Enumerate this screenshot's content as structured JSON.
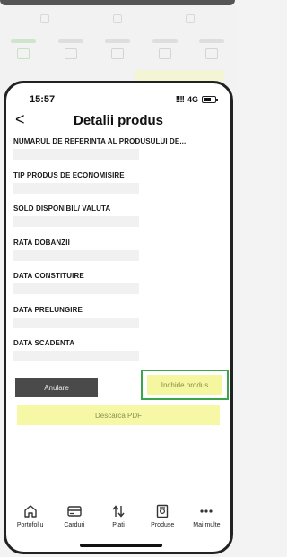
{
  "status_bar": {
    "time": "15:57",
    "signal": "!!!!",
    "network": "4G"
  },
  "header": {
    "back_icon": "chevron-left-icon",
    "back_glyph": "<",
    "title": "Detalii produs"
  },
  "fields": [
    {
      "label": "NUMARUL DE REFERINTA AL PRODUSULUI DE..."
    },
    {
      "label": "TIP PRODUS DE ECONOMISIRE"
    },
    {
      "label": "SOLD DISPONIBIL/ VALUTA"
    },
    {
      "label": "RATA DOBANZII"
    },
    {
      "label": "DATA CONSTITUIRE"
    },
    {
      "label": "DATA PRELUNGIRE"
    },
    {
      "label": "DATA SCADENTA"
    }
  ],
  "actions": {
    "cancel_label": "Anulare",
    "close_product_label": "Inchide produs",
    "pdf_label": "Descarca PDF"
  },
  "tabs": [
    {
      "label": "Portofoliu",
      "icon": "home-icon"
    },
    {
      "label": "Carduri",
      "icon": "card-icon"
    },
    {
      "label": "Plati",
      "icon": "transfer-icon"
    },
    {
      "label": "Produse",
      "icon": "document-icon"
    },
    {
      "label": "Mai multe",
      "icon": "more-icon"
    }
  ],
  "colors": {
    "highlight_border": "#3aa54a",
    "yellow_button": "#f5f7a0",
    "cancel_button": "#4a4a4a"
  }
}
